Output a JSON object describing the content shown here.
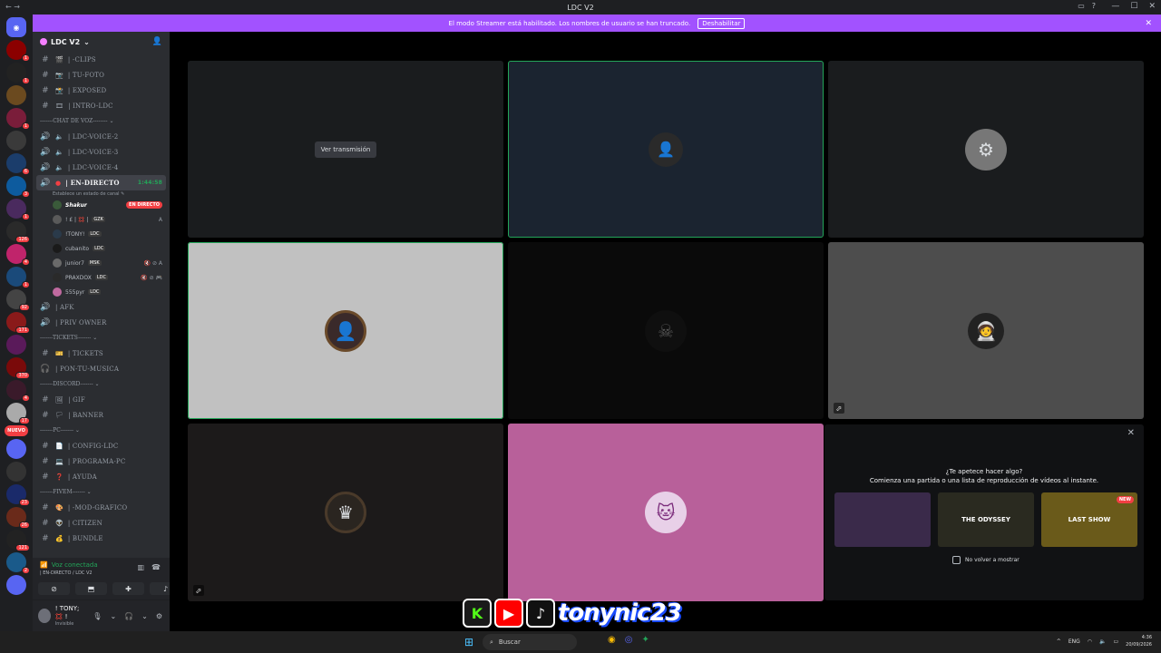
{
  "window": {
    "title": "LDC V2"
  },
  "banner": {
    "text": "El modo Streamer está habilitado. Los nombres de usuario se han truncado.",
    "button": "Deshabilitar"
  },
  "guilds": [
    {
      "color": "#5865f2",
      "badge": ""
    },
    {
      "color": "#8b0000",
      "badge": "1"
    },
    {
      "color": "#222",
      "badge": "1"
    },
    {
      "color": "#6b4a1f",
      "badge": ""
    },
    {
      "color": "#7a1d3a",
      "badge": "1"
    },
    {
      "color": "#3a3a3a",
      "badge": ""
    },
    {
      "color": "#1b3d6b",
      "badge": "6"
    },
    {
      "color": "#0d5b9e",
      "badge": "3"
    },
    {
      "color": "#4a2a5e",
      "badge": "1"
    },
    {
      "color": "#2a2a2a",
      "badge": "126"
    },
    {
      "color": "#c0246b",
      "badge": "4"
    },
    {
      "color": "#1a4a7a",
      "badge": "1"
    },
    {
      "color": "#444",
      "badge": "92"
    },
    {
      "color": "#8a1a1a",
      "badge": "171"
    },
    {
      "color": "#5a1a5a",
      "badge": ""
    },
    {
      "color": "#7a0a0a",
      "badge": "370"
    },
    {
      "color": "#3a1a2a",
      "badge": "4"
    },
    {
      "color": "#aaa",
      "badge": "17"
    },
    {
      "color": "#5865f2",
      "badge": ""
    },
    {
      "color": "#333",
      "badge": ""
    },
    {
      "color": "#1a2a6a",
      "badge": "23"
    },
    {
      "color": "#6a2a1a",
      "badge": "26"
    },
    {
      "color": "#222",
      "badge": "121"
    },
    {
      "color": "#1a5a8a",
      "badge": "2"
    },
    {
      "color": "#5865f2",
      "badge": ""
    }
  ],
  "guilds_new": "NUEVO",
  "server": {
    "name": "LDC V2"
  },
  "channels_top": [
    {
      "pre": "#",
      "emo": "🎬",
      "name": "| -CLIPS"
    },
    {
      "pre": "#",
      "emo": "📷",
      "name": "| TU-FOTO"
    },
    {
      "pre": "#",
      "emo": "📸",
      "name": "| EXPOSED"
    },
    {
      "pre": "#",
      "emo": "🎞",
      "name": "| INTRO-LDC"
    }
  ],
  "cat_voice": "-------CHAT DE VOZ-------- ⌄",
  "voice_channels": [
    {
      "pre": "🔊",
      "emo": "🔈",
      "name": "| LDC-VOICE-2"
    },
    {
      "pre": "🔊",
      "emo": "🔈",
      "name": "| LDC-VOICE-3"
    },
    {
      "pre": "🔊",
      "emo": "🔈",
      "name": "| LDC-VOICE-4"
    }
  ],
  "live_channel": {
    "name": "| EN-DIRECTO",
    "time": "1:44:58",
    "status": "Establece un estado de canal ✎"
  },
  "voice_users": [
    {
      "name": "Shakur",
      "bold": true,
      "tag": "",
      "live": "EN DIRECTO",
      "icons": ""
    },
    {
      "name": "! £ | 💢 |",
      "bold": false,
      "tag": "GZK",
      "live": "",
      "icons": "A"
    },
    {
      "name": "!TONY!",
      "bold": false,
      "tag": "LDC",
      "live": "",
      "icons": ""
    },
    {
      "name": "cubanito",
      "bold": false,
      "tag": "LDC",
      "live": "",
      "icons": ""
    },
    {
      "name": "junior7",
      "bold": false,
      "tag": "MSK",
      "live": "",
      "icons": "🔇 ⊘ A"
    },
    {
      "name": "PRAXDOX",
      "bold": false,
      "tag": "LDC",
      "live": "",
      "icons": "🔇 ⊘ 🎮"
    },
    {
      "name": "555pyr",
      "bold": false,
      "tag": "LDC",
      "live": "",
      "icons": ""
    }
  ],
  "voice_more": [
    {
      "pre": "🔊",
      "emo": "",
      "name": "| AFK"
    },
    {
      "pre": "🔊",
      "emo": "",
      "name": "| PRIV OWNER"
    }
  ],
  "cat_tickets": "-------TICKETS------- ⌄",
  "tickets": [
    {
      "pre": "#",
      "emo": "🎫",
      "name": "| TICKETS"
    },
    {
      "pre": "🎧",
      "emo": "",
      "name": "| PON-TU-MUSICA"
    }
  ],
  "cat_discord": "-------DISCORD------- ⌄",
  "discord": [
    {
      "pre": "#",
      "emo": "🖼",
      "name": "| GIF"
    },
    {
      "pre": "#",
      "emo": "🏳",
      "name": "| BANNER"
    }
  ],
  "cat_pc": "-------PC------- ⌄",
  "pc": [
    {
      "pre": "#",
      "emo": "📄",
      "name": "| CONFIG-LDC"
    },
    {
      "pre": "#",
      "emo": "💻",
      "name": "| PROGRAMA-PC"
    },
    {
      "pre": "#",
      "emo": "❓",
      "name": "| AYUDA"
    }
  ],
  "cat_fivem": "-------FIVEM------- ⌄",
  "fivem": [
    {
      "pre": "#",
      "emo": "🎨",
      "name": "| -MOD-GRAFICO"
    },
    {
      "pre": "#",
      "emo": "👽",
      "name": "| CITIZEN"
    },
    {
      "pre": "#",
      "emo": "💰",
      "name": "| BUNDLE"
    }
  ],
  "voicebar": {
    "title": "Voz conectada",
    "sub": "| EN-DIRECTO / LDC V2"
  },
  "user": {
    "name": "! TONY; 💢 !",
    "status": "Invisible"
  },
  "stream": {
    "watch_label": "Ver transmisión"
  },
  "activities": {
    "title": "¿Te apetece hacer algo?",
    "subtitle": "Comienza una partida o una lista de reproducción de vídeos al instante.",
    "cards": [
      {
        "label": "",
        "bg": "#3a2a4a",
        "new": ""
      },
      {
        "label": "THE ODYSSEY",
        "bg": "#2a2a20",
        "new": ""
      },
      {
        "label": "LAST SHOW",
        "bg": "#6a5a1a",
        "new": "NEW"
      }
    ],
    "dont_show": "No volver a mostrar"
  },
  "overlay": {
    "handle": "tonynic23"
  },
  "taskbar": {
    "search": "Buscar",
    "lang": "ENG",
    "time": "4:36",
    "date": "20/09/2026"
  }
}
